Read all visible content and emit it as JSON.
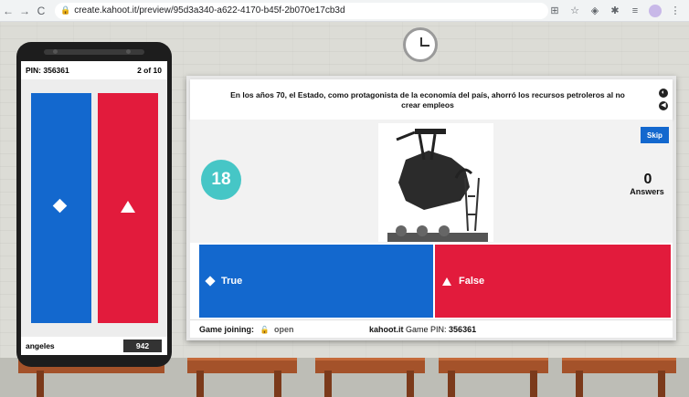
{
  "browser": {
    "url": "create.kahoot.it/preview/95d3a340-a622-4170-b45f-2b070e17cb3d",
    "back_icon": "←",
    "forward_icon": "→",
    "reload_icon": "C"
  },
  "question": {
    "text": "En los años 70, el Estado, como protagonista de la economía del país, ahorró los recursos petroleros al no crear empleos"
  },
  "game": {
    "skip_label": "Skip",
    "timer": "18",
    "answers_count": "0",
    "answers_label": "Answers"
  },
  "answers": [
    {
      "label": "True",
      "color": "#1368ce",
      "shape": "diamond"
    },
    {
      "label": "False",
      "color": "#e21b3c",
      "shape": "triangle"
    }
  ],
  "footer": {
    "game_joining_label": "Game joining:",
    "status": "open",
    "brand": "kahoot.it",
    "pin_label": "Game PIN:",
    "pin": "356361"
  },
  "phone": {
    "pin_text": "PIN: 356361",
    "question_counter": "2 of 10",
    "username": "angeles",
    "score": "942"
  },
  "colors": {
    "timer": "#46c6c6",
    "skip": "#1368ce"
  }
}
